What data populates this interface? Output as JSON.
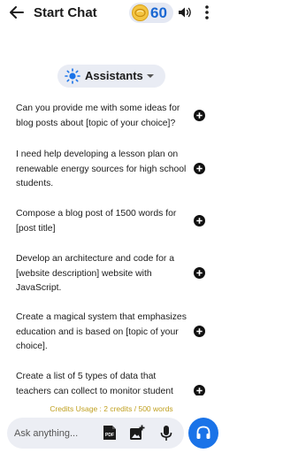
{
  "header": {
    "back_icon": "arrow-left-icon",
    "title": "Start Chat",
    "coins": "60",
    "coin_icon": "coin-icon",
    "volume_icon": "volume-icon",
    "more_icon": "more-vertical-icon"
  },
  "assistants": {
    "label": "Assistants",
    "icon": "sun-icon",
    "caret_icon": "caret-down-icon"
  },
  "prompts": [
    {
      "text": "Can you provide me with some ideas for blog posts about [topic of your choice]?"
    },
    {
      "text": "I need help developing a lesson plan on renewable energy sources for high school students."
    },
    {
      "text": "Compose a blog post of 1500 words for [post title]"
    },
    {
      "text": "Develop an architecture and code for a [website description] website with JavaScript."
    },
    {
      "text": "Create a magical system that emphasizes education and is based on [topic of your choice]."
    },
    {
      "text": "Create a list of 5 types of data that teachers can collect to monitor student"
    }
  ],
  "credits": "Credits Usage : 2 credits / 500 words",
  "input": {
    "placeholder": "Ask anything...",
    "value": ""
  },
  "colors": {
    "accent": "#1a73e8",
    "coin_text": "#1967d2",
    "credits_text": "#c0a020",
    "pill_bg": "#e9ecf4"
  }
}
